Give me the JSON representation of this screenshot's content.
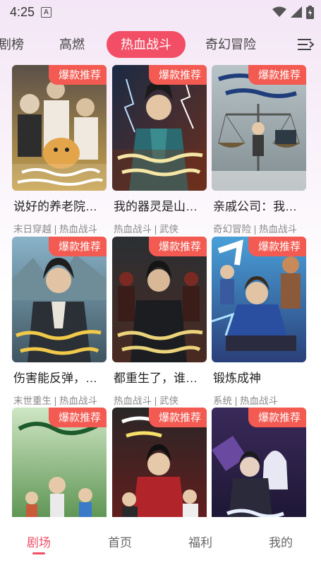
{
  "status": {
    "time": "4:25",
    "notification_letter": "A"
  },
  "tabs": [
    {
      "label": "剧榜",
      "active": false
    },
    {
      "label": "高燃",
      "active": false
    },
    {
      "label": "热血战斗",
      "active": true
    },
    {
      "label": "奇幻冒险",
      "active": false
    }
  ],
  "menu_icon": "list-menu-icon",
  "cards": [
    {
      "badge": "爆款推荐",
      "title": "说好的养老院…",
      "tags": "末日穿越 | 热血战斗"
    },
    {
      "badge": "爆款推荐",
      "title": "我的器灵是山…",
      "tags": "热血战斗 | 武侠"
    },
    {
      "badge": "爆款推荐",
      "title": "亲戚公司：我…",
      "tags": "奇幻冒险 | 热血战斗"
    },
    {
      "badge": "爆款推荐",
      "title": "伤害能反弹，…",
      "tags": "末世重生 | 热血战斗"
    },
    {
      "badge": "爆款推荐",
      "title": "都重生了，谁…",
      "tags": "热血战斗 | 武侠"
    },
    {
      "badge": "爆款推荐",
      "title": "锻炼成神",
      "tags": "系统 | 热血战斗"
    },
    {
      "badge": "爆款推荐",
      "title": "",
      "tags": ""
    },
    {
      "badge": "爆款推荐",
      "title": "",
      "tags": ""
    },
    {
      "badge": "爆款推荐",
      "title": "",
      "tags": ""
    }
  ],
  "bottom_nav": [
    {
      "label": "剧场",
      "active": true
    },
    {
      "label": "首页",
      "active": false
    },
    {
      "label": "福利",
      "active": false
    },
    {
      "label": "我的",
      "active": false
    }
  ],
  "colors": {
    "accent": "#f24f66",
    "badge": "#f35a51",
    "tab_text": "#444444",
    "tag_text": "#888888"
  }
}
